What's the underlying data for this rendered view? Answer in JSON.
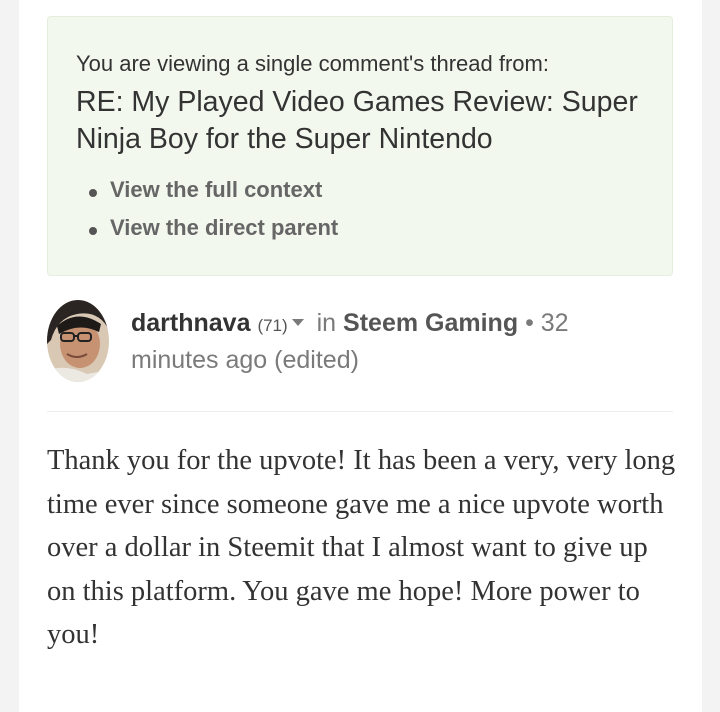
{
  "notice": {
    "intro": "You are viewing a single comment's thread from:",
    "title": "RE: My Played Video Games Review: Super Ninja Boy for the Super Nintendo",
    "links": [
      {
        "label": "View the full context"
      },
      {
        "label": "View the direct parent"
      }
    ]
  },
  "comment": {
    "author": "darthnava",
    "reputation": "(71)",
    "in_label": "in",
    "community": "Steem Gaming",
    "separator": "•",
    "time": "32 minutes ago",
    "edited": "(edited)",
    "body": "Thank you for the upvote! It has been a very, very long time ever since someone gave me a nice upvote worth over a dollar in Steemit that I almost want to give up on this platform. You gave me hope! More power to you!"
  },
  "colors": {
    "notice_bg": "#f2f8ee",
    "text": "#333333",
    "muted": "#7a7a7a"
  }
}
